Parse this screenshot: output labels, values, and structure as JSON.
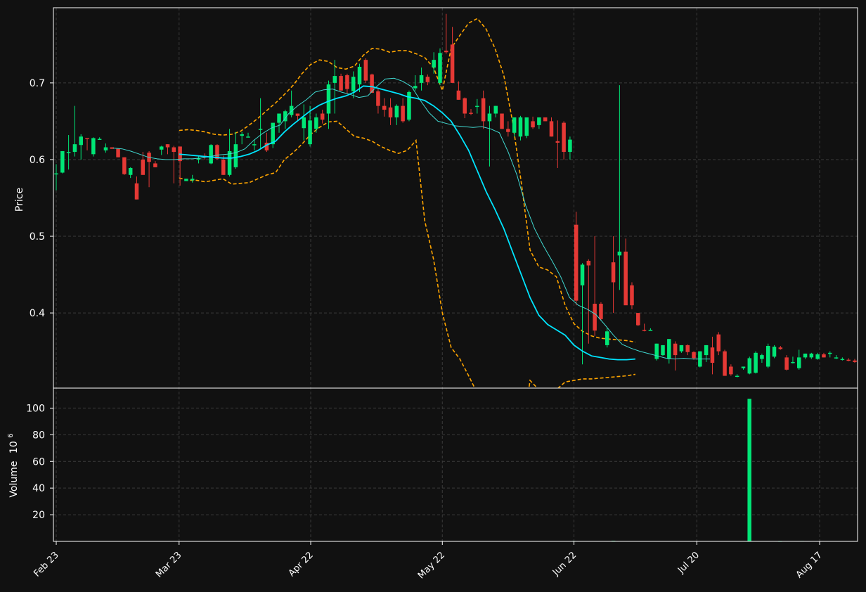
{
  "colors": {
    "background": "#111111",
    "up": "#00e676",
    "down": "#e53935",
    "ma_fast": "#40d8d0",
    "ma_slow": "#00e5ff",
    "bollinger": "#ffa500",
    "grid": "#3a3a3a",
    "axis": "#ffffff"
  },
  "chart_data": {
    "type": "candlestick",
    "grid": true,
    "x_ticks": [
      "Feb 23",
      "Mar 23",
      "Apr 22",
      "May 22",
      "Jun 22",
      "Jul 20",
      "Aug 17"
    ],
    "x_tick_index": [
      0,
      28,
      58,
      88,
      118,
      146,
      174
    ],
    "price_panel": {
      "ylabel": "Price",
      "ylim": [
        0.302,
        0.798
      ],
      "y_ticks": [
        0.4,
        0.5,
        0.6,
        0.7
      ]
    },
    "volume_panel": {
      "ylabel": "Volume",
      "ylabel_exponent": "10",
      "ylabel_power": "6",
      "ylim": [
        0,
        115
      ],
      "y_ticks": [
        20,
        40,
        60,
        80,
        100
      ]
    },
    "candles_ohlc": [
      [
        0.581,
        0.594,
        0.56,
        0.582
      ],
      [
        0.583,
        0.611,
        0.582,
        0.611
      ],
      [
        0.609,
        0.632,
        0.587,
        0.61
      ],
      [
        0.61,
        0.67,
        0.604,
        0.62
      ],
      [
        0.619,
        0.633,
        0.6,
        0.63
      ],
      [
        0.628,
        0.627,
        0.612,
        0.627
      ],
      [
        0.607,
        0.629,
        0.604,
        0.628
      ],
      [
        0.627,
        0.629,
        0.627,
        0.627
      ],
      [
        0.612,
        0.621,
        0.609,
        0.616
      ],
      [
        0.616,
        0.616,
        0.615,
        0.614
      ],
      [
        0.614,
        0.614,
        0.603,
        0.603
      ],
      [
        0.603,
        0.603,
        0.58,
        0.581
      ],
      [
        0.58,
        0.59,
        0.576,
        0.589
      ],
      [
        0.569,
        0.578,
        0.548,
        0.548
      ],
      [
        0.6,
        0.61,
        0.58,
        0.58
      ],
      [
        0.609,
        0.611,
        0.564,
        0.597
      ],
      [
        0.595,
        0.598,
        0.59,
        0.59
      ],
      [
        0.613,
        0.618,
        0.606,
        0.617
      ],
      [
        0.62,
        0.62,
        0.607,
        0.616
      ],
      [
        0.616,
        0.618,
        0.569,
        0.61
      ],
      [
        0.617,
        0.617,
        0.566,
        0.598
      ],
      [
        0.572,
        0.575,
        0.572,
        0.575
      ],
      [
        0.573,
        0.58,
        0.57,
        0.575
      ],
      [
        0.6,
        0.605,
        0.595,
        0.602
      ],
      [
        0.605,
        0.608,
        0.6,
        0.603
      ],
      [
        0.595,
        0.62,
        0.594,
        0.619
      ],
      [
        0.619,
        0.62,
        0.6,
        0.601
      ],
      [
        0.6,
        0.605,
        0.58,
        0.58
      ],
      [
        0.58,
        0.64,
        0.578,
        0.611
      ],
      [
        0.59,
        0.636,
        0.588,
        0.62
      ],
      [
        0.631,
        0.636,
        0.62,
        0.633
      ],
      [
        0.63,
        0.635,
        0.63,
        0.63
      ],
      [
        0.62,
        0.626,
        0.612,
        0.62
      ],
      [
        0.64,
        0.68,
        0.615,
        0.64
      ],
      [
        0.622,
        0.635,
        0.61,
        0.612
      ],
      [
        0.62,
        0.63,
        0.615,
        0.648
      ],
      [
        0.648,
        0.66,
        0.635,
        0.66
      ],
      [
        0.65,
        0.665,
        0.64,
        0.663
      ],
      [
        0.658,
        0.69,
        0.655,
        0.67
      ],
      [
        0.66,
        0.66,
        0.65,
        0.657
      ],
      [
        0.641,
        0.672,
        0.625,
        0.655
      ],
      [
        0.62,
        0.67,
        0.617,
        0.651
      ],
      [
        0.64,
        0.66,
        0.635,
        0.655
      ],
      [
        0.66,
        0.665,
        0.647,
        0.652
      ],
      [
        0.66,
        0.703,
        0.64,
        0.698
      ],
      [
        0.7,
        0.73,
        0.66,
        0.709
      ],
      [
        0.709,
        0.712,
        0.69,
        0.69
      ],
      [
        0.71,
        0.712,
        0.686,
        0.692
      ],
      [
        0.689,
        0.715,
        0.68,
        0.708
      ],
      [
        0.698,
        0.725,
        0.688,
        0.721
      ],
      [
        0.73,
        0.732,
        0.7,
        0.703
      ],
      [
        0.711,
        0.712,
        0.687,
        0.687
      ],
      [
        0.689,
        0.692,
        0.66,
        0.67
      ],
      [
        0.67,
        0.68,
        0.656,
        0.665
      ],
      [
        0.668,
        0.68,
        0.645,
        0.655
      ],
      [
        0.655,
        0.672,
        0.645,
        0.67
      ],
      [
        0.67,
        0.68,
        0.648,
        0.65
      ],
      [
        0.652,
        0.69,
        0.65,
        0.688
      ],
      [
        0.693,
        0.71,
        0.69,
        0.696
      ],
      [
        0.7,
        0.72,
        0.69,
        0.71
      ],
      [
        0.708,
        0.711,
        0.697,
        0.701
      ],
      [
        0.72,
        0.74,
        0.712,
        0.73
      ],
      [
        0.7,
        0.745,
        0.697,
        0.739
      ],
      [
        0.742,
        0.79,
        0.738,
        0.74
      ],
      [
        0.75,
        0.773,
        0.7,
        0.7
      ],
      [
        0.69,
        0.702,
        0.678,
        0.678
      ],
      [
        0.68,
        0.681,
        0.654,
        0.66
      ],
      [
        0.661,
        0.666,
        0.658,
        0.66
      ],
      [
        0.67,
        0.679,
        0.66,
        0.67
      ],
      [
        0.68,
        0.69,
        0.64,
        0.65
      ],
      [
        0.65,
        0.67,
        0.591,
        0.66
      ],
      [
        0.66,
        0.67,
        0.655,
        0.67
      ],
      [
        0.66,
        0.66,
        0.64,
        0.64
      ],
      [
        0.64,
        0.65,
        0.63,
        0.636
      ],
      [
        0.635,
        0.655,
        0.63,
        0.655
      ],
      [
        0.63,
        0.657,
        0.625,
        0.655
      ],
      [
        0.631,
        0.654,
        0.628,
        0.655
      ],
      [
        0.65,
        0.656,
        0.64,
        0.642
      ],
      [
        0.645,
        0.655,
        0.64,
        0.655
      ],
      [
        0.655,
        0.655,
        0.65,
        0.65
      ],
      [
        0.65,
        0.655,
        0.63,
        0.63
      ],
      [
        0.624,
        0.651,
        0.589,
        0.622
      ],
      [
        0.648,
        0.65,
        0.6,
        0.61
      ],
      [
        0.61,
        0.63,
        0.6,
        0.626
      ],
      [
        0.515,
        0.532,
        0.41,
        0.416
      ],
      [
        0.436,
        0.465,
        0.333,
        0.463
      ],
      [
        0.468,
        0.47,
        0.36,
        0.462
      ],
      [
        0.412,
        0.5,
        0.37,
        0.377
      ],
      [
        0.412,
        0.414,
        0.39,
        0.392
      ],
      [
        0.358,
        0.38,
        0.355,
        0.376
      ],
      [
        0.466,
        0.5,
        0.4,
        0.44
      ],
      [
        0.475,
        0.697,
        0.43,
        0.48
      ],
      [
        0.48,
        0.497,
        0.425,
        0.41
      ],
      [
        0.436,
        0.44,
        0.405,
        0.41
      ],
      [
        0.4,
        0.4,
        0.383,
        0.384
      ],
      [
        0.378,
        0.386,
        0.376,
        0.377
      ],
      [
        0.378,
        0.38,
        0.377,
        0.378
      ],
      [
        0.34,
        0.36,
        0.338,
        0.36
      ],
      [
        0.345,
        0.358,
        0.344,
        0.358
      ],
      [
        0.34,
        0.366,
        0.334,
        0.366
      ],
      [
        0.36,
        0.363,
        0.325,
        0.345
      ],
      [
        0.35,
        0.358,
        0.348,
        0.358
      ],
      [
        0.358,
        0.359,
        0.345,
        0.349
      ],
      [
        0.349,
        0.35,
        0.339,
        0.341
      ],
      [
        0.33,
        0.35,
        0.329,
        0.35
      ],
      [
        0.345,
        0.358,
        0.336,
        0.358
      ],
      [
        0.355,
        0.369,
        0.32,
        0.335
      ],
      [
        0.372,
        0.375,
        0.345,
        0.35
      ],
      [
        0.35,
        0.352,
        0.318,
        0.318
      ],
      [
        0.33,
        0.333,
        0.318,
        0.32
      ],
      [
        0.318,
        0.32,
        0.316,
        0.318
      ],
      [
        0.328,
        0.33,
        0.326,
        0.33
      ],
      [
        0.321,
        0.343,
        0.32,
        0.341
      ],
      [
        0.322,
        0.35,
        0.321,
        0.348
      ],
      [
        0.34,
        0.347,
        0.335,
        0.345
      ],
      [
        0.33,
        0.36,
        0.328,
        0.357
      ],
      [
        0.343,
        0.358,
        0.341,
        0.356
      ],
      [
        0.355,
        0.357,
        0.352,
        0.353
      ],
      [
        0.342,
        0.345,
        0.325,
        0.326
      ],
      [
        0.336,
        0.343,
        0.334,
        0.336
      ],
      [
        0.328,
        0.352,
        0.326,
        0.342
      ],
      [
        0.342,
        0.347,
        0.34,
        0.347
      ],
      [
        0.342,
        0.348,
        0.34,
        0.347
      ],
      [
        0.34,
        0.348,
        0.339,
        0.346
      ],
      [
        0.346,
        0.348,
        0.342,
        0.342
      ],
      [
        0.348,
        0.35,
        0.342,
        0.348
      ],
      [
        0.342,
        0.345,
        0.34,
        0.342
      ],
      [
        0.34,
        0.342,
        0.338,
        0.34
      ],
      [
        0.339,
        0.341,
        0.337,
        0.338
      ],
      [
        0.338,
        0.34,
        0.335,
        0.336
      ]
    ],
    "candles_x_index": [
      0,
      1,
      2,
      3,
      4,
      5,
      6,
      7,
      8,
      9,
      10,
      11,
      12,
      13,
      14,
      15,
      16,
      17,
      18,
      19,
      20,
      21,
      22,
      23,
      24,
      25,
      26,
      27,
      28,
      29,
      30,
      31,
      32,
      33,
      34,
      35,
      36,
      37,
      38,
      39,
      40,
      41,
      42,
      43,
      44,
      45,
      46,
      47,
      48,
      49,
      50,
      51,
      52,
      53,
      54,
      55,
      56,
      57,
      58,
      59,
      60,
      61,
      62,
      63,
      64,
      65,
      66,
      67,
      68,
      69,
      70,
      71,
      72,
      73,
      74,
      75,
      76,
      77,
      78,
      79,
      80,
      81,
      82,
      83,
      84,
      85,
      86,
      87,
      88,
      89,
      90,
      91,
      92,
      93,
      94,
      95,
      96,
      97,
      98,
      99,
      100,
      101,
      102,
      103,
      104,
      105,
      106,
      107,
      108,
      109,
      110,
      111,
      112,
      113,
      114,
      115,
      116,
      117,
      118,
      119,
      120,
      121,
      122,
      123,
      124,
      125,
      126,
      127,
      128,
      129
    ],
    "ma_fast": [
      0.615,
      0.614,
      0.611,
      0.607,
      0.603,
      0.601,
      0.6,
      0.6,
      0.601,
      0.601,
      0.602,
      0.604,
      0.606,
      0.607,
      0.609,
      0.614,
      0.625,
      0.634,
      0.641,
      0.645,
      0.66,
      0.67,
      0.678,
      0.688,
      0.691,
      0.692,
      0.688,
      0.685,
      0.681,
      0.683,
      0.695,
      0.705,
      0.706,
      0.702,
      0.695,
      0.677,
      0.661,
      0.65,
      0.647,
      0.644,
      0.643,
      0.642,
      0.643,
      0.64,
      0.635,
      0.61,
      0.58,
      0.54,
      0.51,
      0.488,
      0.468,
      0.447,
      0.42,
      0.41,
      0.405,
      0.398,
      0.385,
      0.371,
      0.359,
      0.354,
      0.35,
      0.347,
      0.344,
      0.341,
      0.34,
      0.341,
      0.34,
      0.34,
      0.34
    ],
    "ma_fast_x": [
      13,
      15,
      17,
      19,
      21,
      23,
      25,
      27,
      29,
      31,
      33,
      35,
      37,
      39,
      41,
      43,
      45,
      47,
      49,
      51,
      53,
      55,
      57,
      59,
      61,
      63,
      65,
      67,
      69,
      71,
      73,
      75,
      77,
      79,
      81,
      83,
      85,
      87,
      89,
      91,
      93,
      95,
      97,
      99,
      101,
      103,
      105,
      107,
      109,
      111,
      113,
      115,
      117,
      119,
      121,
      123,
      125,
      127,
      129,
      131,
      133,
      135,
      137,
      139,
      141,
      143,
      145,
      147,
      149
    ],
    "ma_slow": [
      0.607,
      0.606,
      0.605,
      0.604,
      0.603,
      0.602,
      0.602,
      0.604,
      0.607,
      0.612,
      0.619,
      0.624,
      0.636,
      0.646,
      0.655,
      0.664,
      0.671,
      0.676,
      0.68,
      0.683,
      0.688,
      0.696,
      0.695,
      0.692,
      0.689,
      0.686,
      0.682,
      0.68,
      0.677,
      0.67,
      0.661,
      0.65,
      0.632,
      0.612,
      0.585,
      0.558,
      0.535,
      0.51,
      0.48,
      0.45,
      0.42,
      0.397,
      0.385,
      0.378,
      0.371,
      0.358,
      0.35,
      0.344,
      0.342,
      0.34,
      0.339,
      0.339,
      0.34
    ],
    "ma_slow_x": [
      28,
      30,
      32,
      34,
      36,
      38,
      40,
      42,
      44,
      46,
      48,
      50,
      52,
      54,
      56,
      58,
      60,
      62,
      64,
      66,
      68,
      70,
      72,
      74,
      76,
      78,
      80,
      82,
      84,
      86,
      88,
      90,
      92,
      94,
      96,
      98,
      100,
      102,
      104,
      106,
      108,
      110,
      112,
      114,
      116,
      118,
      120,
      122,
      124,
      126,
      128,
      130,
      132
    ],
    "bollinger_upper": [
      0.638,
      0.639,
      0.638,
      0.636,
      0.633,
      0.632,
      0.633,
      0.637,
      0.645,
      0.654,
      0.664,
      0.674,
      0.685,
      0.697,
      0.712,
      0.724,
      0.73,
      0.728,
      0.72,
      0.718,
      0.722,
      0.736,
      0.745,
      0.744,
      0.74,
      0.742,
      0.742,
      0.738,
      0.733,
      0.72,
      0.69,
      0.745,
      0.762,
      0.778,
      0.784,
      0.77,
      0.745,
      0.71,
      0.65,
      0.57,
      0.482,
      0.46,
      0.456,
      0.447,
      0.41,
      0.386,
      0.376,
      0.37,
      0.367,
      0.366,
      0.365,
      0.364,
      0.362
    ],
    "bollinger_lower": [
      0.576,
      0.573,
      0.573,
      0.571,
      0.573,
      0.575,
      0.568,
      0.569,
      0.57,
      0.575,
      0.58,
      0.583,
      0.6,
      0.609,
      0.62,
      0.633,
      0.642,
      0.649,
      0.65,
      0.64,
      0.63,
      0.628,
      0.624,
      0.617,
      0.612,
      0.608,
      0.612,
      0.625,
      0.52,
      0.47,
      0.4,
      0.355,
      0.34,
      0.318,
      0.295,
      0.28,
      0.265,
      0.25,
      0.24,
      0.235,
      0.312,
      0.3,
      0.296,
      0.3,
      0.31,
      0.312,
      0.314,
      0.314,
      0.315,
      0.316,
      0.317,
      0.318,
      0.32
    ],
    "bollinger_x": [
      28,
      30,
      32,
      34,
      36,
      38,
      40,
      42,
      44,
      46,
      48,
      50,
      52,
      54,
      56,
      58,
      60,
      62,
      64,
      66,
      68,
      70,
      72,
      74,
      76,
      78,
      80,
      82,
      84,
      86,
      88,
      90,
      92,
      94,
      96,
      98,
      100,
      102,
      104,
      106,
      108,
      110,
      112,
      114,
      116,
      118,
      120,
      122,
      124,
      126,
      128,
      130,
      132
    ],
    "volume": {
      "x_index": [
        118,
        127,
        158,
        165,
        170
      ],
      "values": [
        0.3,
        0.4,
        107,
        0.2,
        0.3
      ],
      "colors": [
        "up",
        "up",
        "up",
        "up",
        "up"
      ]
    }
  }
}
